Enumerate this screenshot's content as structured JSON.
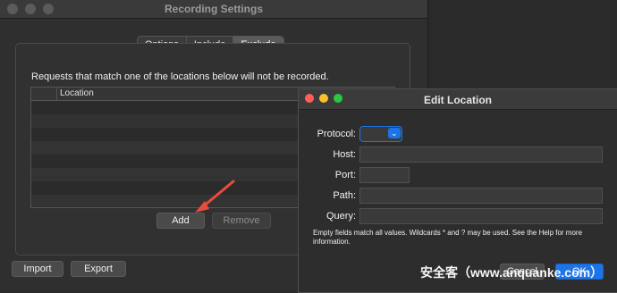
{
  "window": {
    "title": "Recording Settings"
  },
  "tabs": [
    {
      "label": "Options"
    },
    {
      "label": "Include"
    },
    {
      "label": "Exclude"
    }
  ],
  "panel": {
    "description": "Requests that match one of the locations below will not be recorded.",
    "table": {
      "columns": [
        "Location"
      ],
      "rows": []
    }
  },
  "buttons": {
    "add": "Add",
    "remove": "Remove",
    "import": "Import",
    "export": "Export",
    "cancel": "Cancel",
    "ok": "OK"
  },
  "dialog": {
    "title": "Edit Location",
    "labels": {
      "protocol": "Protocol:",
      "host": "Host:",
      "port": "Port:",
      "path": "Path:",
      "query": "Query:"
    },
    "values": {
      "protocol": "",
      "host": "",
      "port": "",
      "path": "",
      "query": ""
    },
    "note": "Empty fields match all values. Wildcards * and ? may be used. See the Help for more information."
  },
  "watermark": "安全客（www.anquanke.com）",
  "colors": {
    "accent": "#1d74e8",
    "window_bg": "#2f2f2f",
    "dialog_bg": "#2d2d2d",
    "arrow": "#e74c3c"
  },
  "icons": {
    "dropdown": "chevron-down-icon"
  }
}
